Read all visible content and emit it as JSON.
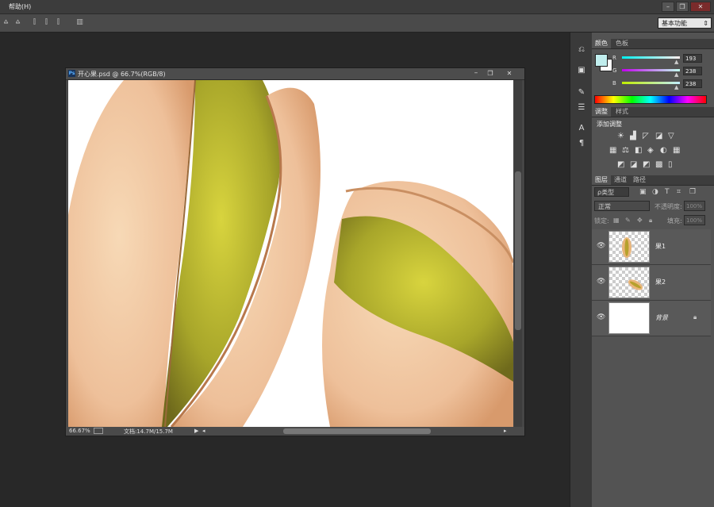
{
  "menu": {
    "help_label": "帮助(H)"
  },
  "window_controls": {
    "minimize": "–",
    "restore": "❐",
    "close": "✕"
  },
  "options_bar": {
    "workspace_label": "基本功能"
  },
  "icons": {
    "align": "align-icon",
    "history": "history-icon",
    "brush": "brush-preset-icon",
    "character": "character-icon",
    "paragraph": "paragraph-icon"
  },
  "color_panel": {
    "tabs": [
      "颜色",
      "色板"
    ],
    "foreground": "#c1eeee",
    "background": "#ffffff",
    "channels": [
      {
        "label": "R",
        "value": "193",
        "gradient": "linear-gradient(90deg,#00eeee,#ffeeee)"
      },
      {
        "label": "G",
        "value": "238",
        "gradient": "linear-gradient(90deg,#c100ee,#c1ffee)"
      },
      {
        "label": "B",
        "value": "238",
        "gradient": "linear-gradient(90deg,#c1ee00,#c1eeff)"
      }
    ]
  },
  "adjust_panel": {
    "tabs": [
      "调整",
      "样式"
    ],
    "add_label": "添加调整"
  },
  "layers_panel": {
    "tabs": [
      "图层",
      "通道",
      "路径"
    ],
    "filter_label": "ρ类型",
    "blend_mode": "正常",
    "opacity_label": "不透明度:",
    "opacity_value": "100%",
    "lock_label": "锁定:",
    "fill_label": "填充:",
    "fill_value": "100%",
    "layers": [
      {
        "name": "果1",
        "type": "pixel",
        "visible": true
      },
      {
        "name": "果2",
        "type": "pixel",
        "visible": true
      },
      {
        "name": "背景",
        "type": "background",
        "visible": true,
        "locked": true
      }
    ]
  },
  "document": {
    "title": "开心果.psd @ 66.7%(RGB/8)",
    "app_badge": "Ps",
    "zoom": "66.67%",
    "doc_info": "文档:14.7M/15.7M"
  }
}
